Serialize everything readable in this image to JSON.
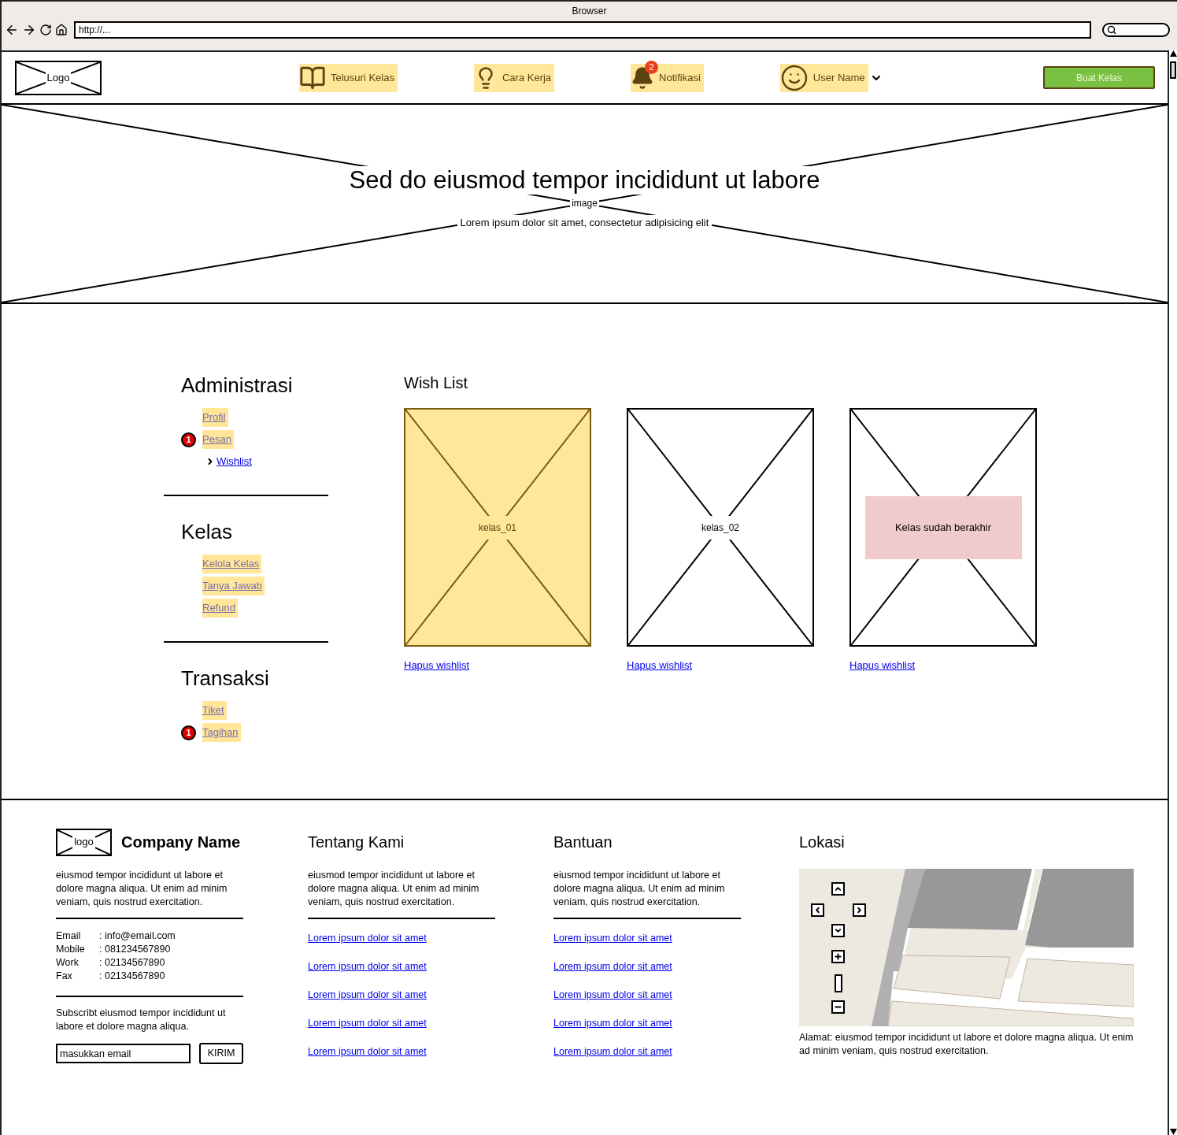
{
  "browser": {
    "title": "Browser",
    "url": "http://..."
  },
  "header": {
    "logo": "Logo",
    "nav": [
      {
        "kind": "book",
        "label": "Telusuri Kelas"
      },
      {
        "kind": "bulb",
        "label": "Cara Kerja"
      },
      {
        "kind": "bell",
        "label": "Notifikasi",
        "badge": "2"
      },
      {
        "kind": "user",
        "label": "User Name",
        "dropdown": true
      }
    ],
    "cta": "Buat Kelas"
  },
  "hero": {
    "image_label": "image",
    "title": "Sed do eiusmod tempor incididunt ut labore",
    "subtitle": "Lorem ipsum dolor sit amet, consectetur adipisicing elit"
  },
  "sidebar": [
    {
      "title": "Administrasi",
      "items": [
        {
          "label": "Profil",
          "selected": false
        },
        {
          "label": "Pesan",
          "selected": false,
          "badge": "1"
        },
        {
          "label": "Wishlist",
          "selected": true
        }
      ]
    },
    {
      "title": "Kelas",
      "items": [
        {
          "label": "Kelola Kelas",
          "selected": false
        },
        {
          "label": "Tanya Jawab",
          "selected": false
        },
        {
          "label": "Refund",
          "selected": false
        }
      ]
    },
    {
      "title": "Transaksi",
      "items": [
        {
          "label": "Tiket",
          "selected": false
        },
        {
          "label": "Tagihan",
          "selected": false,
          "badge": "1"
        }
      ]
    }
  ],
  "wishlist": {
    "title": "Wish List",
    "items": [
      {
        "label": "kelas_01",
        "selected": true,
        "action": "Hapus wishlist"
      },
      {
        "label": "kelas_02",
        "selected": false,
        "action": "Hapus wishlist"
      },
      {
        "label": "Kelas sudah berakhir",
        "selected": false,
        "overlay": true,
        "action": "Hapus wishlist"
      }
    ]
  },
  "footer": {
    "logo": "logo",
    "company": "Company Name",
    "description": "eiusmod tempor incididunt ut labore et dolore magna aliqua. Ut enim ad minim veniam, quis nostrud exercitation.",
    "contacts": [
      {
        "label": "Email",
        "value": ": info@email.com"
      },
      {
        "label": "Mobile",
        "value": ": 081234567890"
      },
      {
        "label": "Work",
        "value": ": 02134567890"
      },
      {
        "label": "Fax",
        "value": ": 02134567890"
      }
    ],
    "subscribe_text": "Subscribt eiusmod tempor incididunt ut labore et dolore magna aliqua.",
    "email_placeholder": "masukkan email",
    "submit": "KIRIM",
    "columns": [
      {
        "title": "Tentang Kami",
        "text": "eiusmod tempor incididunt ut labore et dolore magna aliqua. Ut enim ad minim veniam, quis nostrud exercitation.",
        "links": [
          "Lorem ipsum dolor sit amet",
          "Lorem ipsum dolor sit amet",
          "Lorem ipsum dolor sit amet",
          "Lorem ipsum dolor sit amet",
          "Lorem ipsum dolor sit amet"
        ]
      },
      {
        "title": "Bantuan",
        "text": "eiusmod tempor incididunt ut labore et dolore magna aliqua. Ut enim ad minim veniam, quis nostrud exercitation.",
        "links": [
          "Lorem ipsum dolor sit amet",
          "Lorem ipsum dolor sit amet",
          "Lorem ipsum dolor sit amet",
          "Lorem ipsum dolor sit amet",
          "Lorem ipsum dolor sit amet"
        ]
      }
    ],
    "location": {
      "title": "Lokasi",
      "address": "Alamat: eiusmod tempor incididunt ut labore et dolore magna aliqua. Ut enim ad minim veniam, quis nostrud exercitation."
    }
  }
}
